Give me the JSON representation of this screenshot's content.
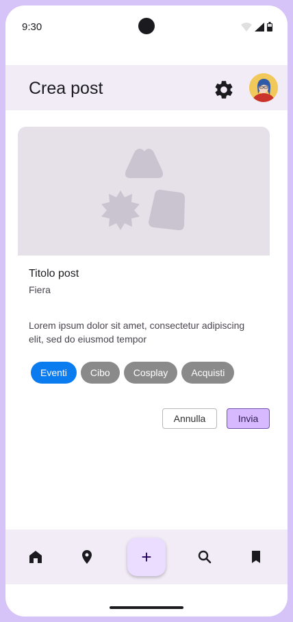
{
  "status_bar": {
    "time": "9:30"
  },
  "header": {
    "title": "Crea post"
  },
  "post": {
    "title": "Titolo post",
    "subtitle": "Fiera",
    "body": "Lorem ipsum dolor sit amet, consectetur adipiscing elit, sed do eiusmod tempor"
  },
  "chips": [
    {
      "label": "Eventi",
      "selected": true
    },
    {
      "label": "Cibo",
      "selected": false
    },
    {
      "label": "Cosplay",
      "selected": false
    },
    {
      "label": "Acquisti",
      "selected": false
    }
  ],
  "actions": {
    "cancel_label": "Annulla",
    "send_label": "Invia"
  },
  "bottom_nav": {
    "items": [
      {
        "icon": "home-icon"
      },
      {
        "icon": "location-pin-icon"
      },
      {
        "icon": "add-icon",
        "label": "+"
      },
      {
        "icon": "search-icon"
      },
      {
        "icon": "bookmark-icon"
      }
    ]
  },
  "colors": {
    "frame": "#d6c3f7",
    "app_bar": "#f2ecf7",
    "chip_selected": "#0a7cf0",
    "chip_default": "#8a8a8a",
    "send_button": "#d7b9ff"
  }
}
